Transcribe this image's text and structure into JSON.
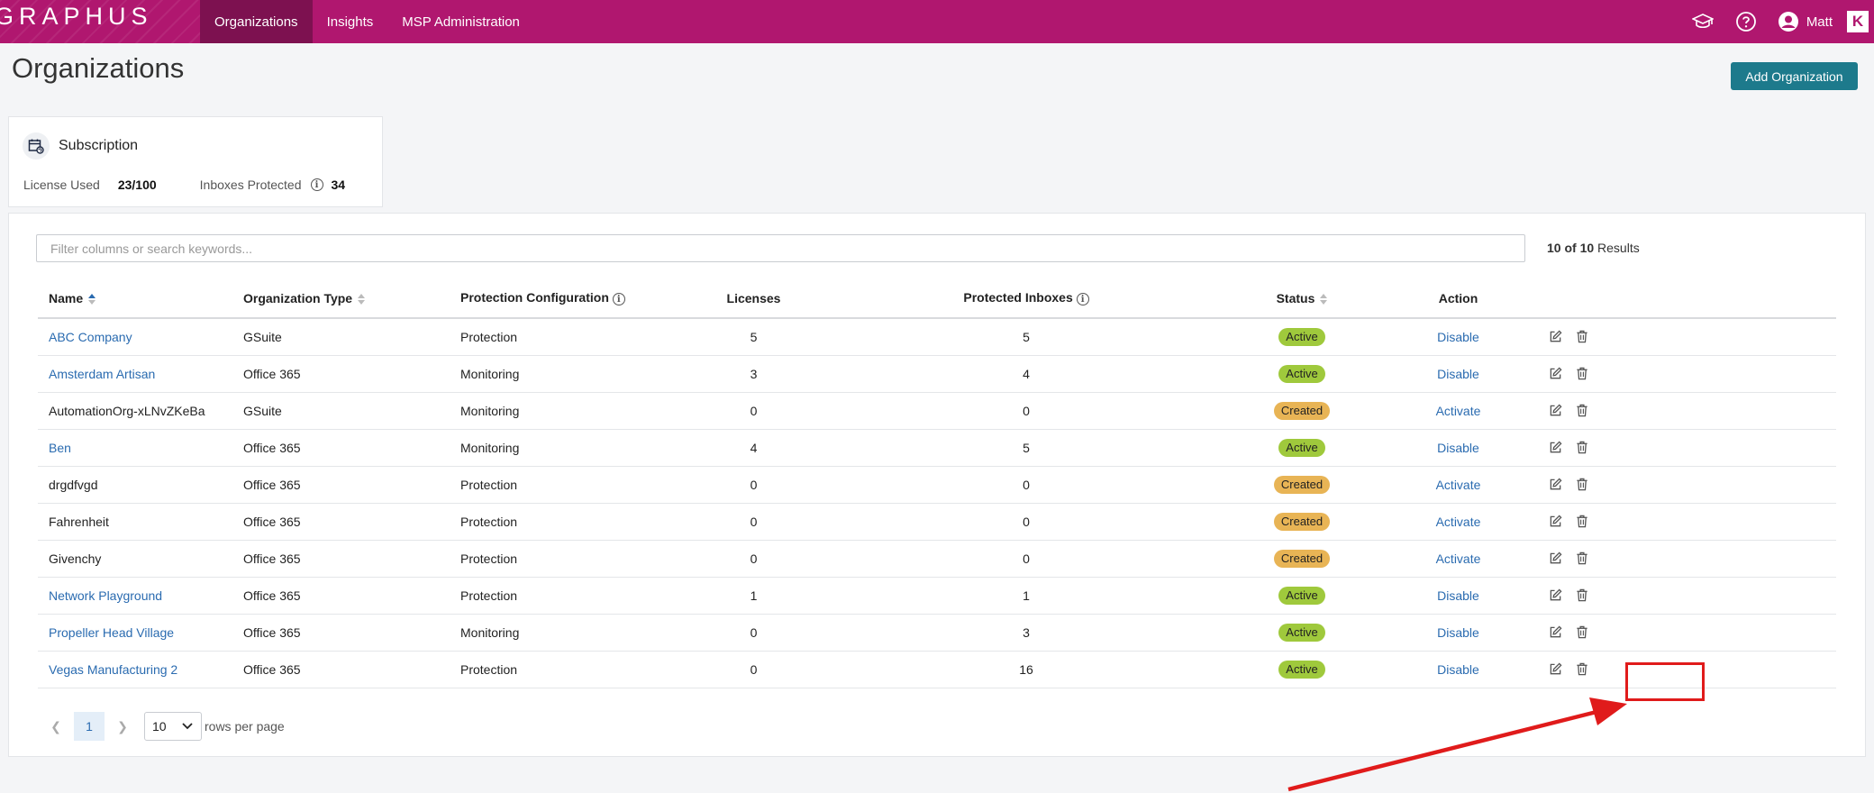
{
  "brand": {
    "name": "GRAPHUS"
  },
  "nav": [
    {
      "label": "Organizations",
      "active": true
    },
    {
      "label": "Insights",
      "active": false
    },
    {
      "label": "MSP Administration",
      "active": false
    }
  ],
  "top_right": {
    "user_name": "Matt",
    "logo_letter": "K"
  },
  "page": {
    "title": "Organizations",
    "add_button": "Add Organization"
  },
  "subscription": {
    "title": "Subscription",
    "license_label": "License Used",
    "license_value": "23/100",
    "inboxes_label": "Inboxes Protected",
    "inboxes_value": "34"
  },
  "search": {
    "placeholder": "Filter columns or search keywords..."
  },
  "results": {
    "count": "10 of 10",
    "suffix": "Results"
  },
  "table": {
    "columns": {
      "name": "Name",
      "org_type": "Organization Type",
      "protection": "Protection Configuration",
      "licenses": "Licenses",
      "inboxes": "Protected Inboxes",
      "status": "Status",
      "action": "Action"
    },
    "rows": [
      {
        "name": "ABC Company",
        "linked": true,
        "type": "GSuite",
        "protection": "Protection",
        "licenses": "5",
        "inboxes": "5",
        "status": "Active",
        "action": "Disable"
      },
      {
        "name": "Amsterdam Artisan",
        "linked": true,
        "type": "Office 365",
        "protection": "Monitoring",
        "licenses": "3",
        "inboxes": "4",
        "status": "Active",
        "action": "Disable"
      },
      {
        "name": "AutomationOrg-xLNvZKeBa",
        "linked": false,
        "type": "GSuite",
        "protection": "Monitoring",
        "licenses": "0",
        "inboxes": "0",
        "status": "Created",
        "action": "Activate"
      },
      {
        "name": "Ben",
        "linked": true,
        "type": "Office 365",
        "protection": "Monitoring",
        "licenses": "4",
        "inboxes": "5",
        "status": "Active",
        "action": "Disable"
      },
      {
        "name": "drgdfvgd",
        "linked": false,
        "type": "Office 365",
        "protection": "Protection",
        "licenses": "0",
        "inboxes": "0",
        "status": "Created",
        "action": "Activate"
      },
      {
        "name": "Fahrenheit",
        "linked": false,
        "type": "Office 365",
        "protection": "Protection",
        "licenses": "0",
        "inboxes": "0",
        "status": "Created",
        "action": "Activate"
      },
      {
        "name": "Givenchy",
        "linked": false,
        "type": "Office 365",
        "protection": "Protection",
        "licenses": "0",
        "inboxes": "0",
        "status": "Created",
        "action": "Activate"
      },
      {
        "name": "Network Playground",
        "linked": true,
        "type": "Office 365",
        "protection": "Protection",
        "licenses": "1",
        "inboxes": "1",
        "status": "Active",
        "action": "Disable"
      },
      {
        "name": "Propeller Head Village",
        "linked": true,
        "type": "Office 365",
        "protection": "Monitoring",
        "licenses": "0",
        "inboxes": "3",
        "status": "Active",
        "action": "Disable"
      },
      {
        "name": "Vegas Manufacturing 2",
        "linked": true,
        "type": "Office 365",
        "protection": "Protection",
        "licenses": "0",
        "inboxes": "16",
        "status": "Active",
        "action": "Disable"
      }
    ]
  },
  "pagination": {
    "current_page": "1",
    "rows_per_page": "10",
    "rows_label": "rows per page"
  },
  "colors": {
    "topbar": "#b0176f",
    "topbar_active": "#7d1150",
    "primary_button": "#1d7a8c",
    "link": "#2a6bb0",
    "active_badge": "#9fc93c",
    "created_badge": "#e8b455",
    "annotation": "#e01b1b"
  }
}
